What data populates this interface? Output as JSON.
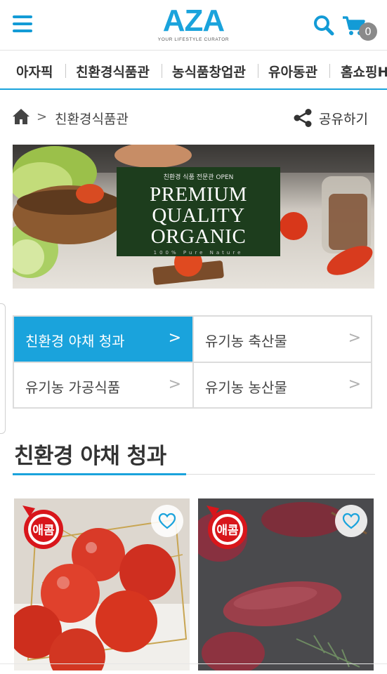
{
  "header": {
    "logo": "AZA",
    "logo_sub": "YOUR LIFESTYLE CURATOR",
    "cart_count": "0",
    "menu_icon": "hamburger-icon",
    "search_icon": "search-icon",
    "cart_icon": "cart-icon",
    "accent_color": "#1aa3dc"
  },
  "category_nav": {
    "items": [
      "아자픽",
      "친환경식품관",
      "농식품창업관",
      "유아동관",
      "홈쇼핑H"
    ]
  },
  "breadcrumb": {
    "home_icon": "home-icon",
    "current": "친환경식품관",
    "share_label": "공유하기",
    "share_icon": "share-icon"
  },
  "banner": {
    "small": "친환경 식품 전문관 OPEN",
    "line1": "PREMIUM",
    "line2": "QUALITY",
    "line3": "ORGANIC",
    "tiny": "100% Pure Nature"
  },
  "subcategories": [
    {
      "label": "친환경 야채 청과",
      "active": true
    },
    {
      "label": "유기농 축산물",
      "active": false
    },
    {
      "label": "유기농 가공식품",
      "active": false
    },
    {
      "label": "유기농 농산물",
      "active": false
    }
  ],
  "section": {
    "title": "친환경 야채 청과"
  },
  "products": [
    {
      "badge": "애콤",
      "image": "tomatoes in gold wire basket",
      "favorite_icon": "heart-outline-icon"
    },
    {
      "badge": "애콤",
      "image": "sweet potatoes on slate",
      "favorite_icon": "heart-outline-icon"
    }
  ]
}
